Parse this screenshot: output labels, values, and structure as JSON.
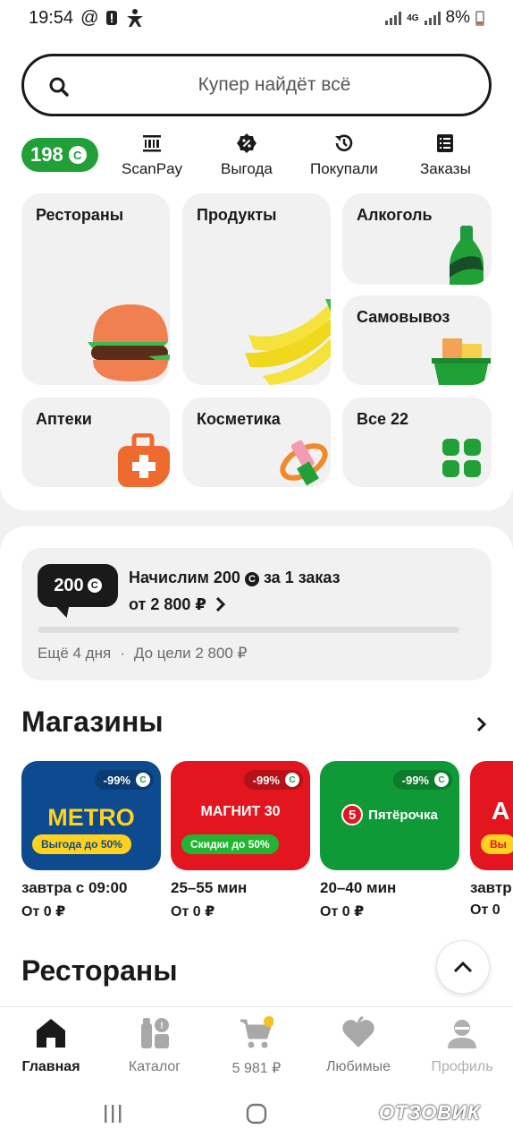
{
  "status_bar": {
    "time": "19:54",
    "battery": "8%",
    "network": "4G"
  },
  "search": {
    "placeholder": "Купер найдёт всё"
  },
  "bonus": {
    "amount": "198",
    "coin_symbol": "С"
  },
  "quick_actions": [
    {
      "label": "ScanPay",
      "icon": "barcode-scan-icon"
    },
    {
      "label": "Выгода",
      "icon": "discount-badge-icon"
    },
    {
      "label": "Покупали",
      "icon": "history-icon"
    },
    {
      "label": "Заказы",
      "icon": "orders-list-icon"
    }
  ],
  "categories": [
    {
      "label": "Рестораны",
      "icon": "burger-icon"
    },
    {
      "label": "Продукты",
      "icon": "banana-icon"
    },
    {
      "label": "Алкоголь",
      "icon": "bottle-icon"
    },
    {
      "label": "Самовывоз",
      "icon": "basket-icon"
    },
    {
      "label": "Аптеки",
      "icon": "first-aid-bag-icon"
    },
    {
      "label": "Косметика",
      "icon": "lipstick-icon"
    },
    {
      "label": "Все 22",
      "icon": "grid-icon"
    }
  ],
  "promo": {
    "bubble_amount": "200",
    "line1_a": "Начислим 200",
    "line1_b": "за 1 заказ",
    "line2": "от 2 800 ₽",
    "progress_fraction": 0.0,
    "days_left": "Ещё 4 дня",
    "separator": "·",
    "goal": "До цели 2 800 ₽"
  },
  "stores_section": {
    "title": "Магазины"
  },
  "stores": [
    {
      "name": "METRO",
      "discount": "-99%",
      "badge": "Выгода до 50%",
      "time": "завтра с 09:00",
      "price": "От 0 ₽",
      "bg": "#0d4a8f",
      "badge_bg": "#ffd21f",
      "badge_color": "#0d4a8f",
      "logo_color": "#ffd21f"
    },
    {
      "name": "МАГНИТ 30",
      "discount": "-99%",
      "badge": "Скидки до 50%",
      "time": "25–55 мин",
      "price": "От 0 ₽",
      "bg": "#e3161f",
      "badge_bg": "#21b532",
      "badge_color": "#ffffff",
      "logo_color": "#ffffff"
    },
    {
      "name": "Пятёрочка",
      "discount": "-99%",
      "badge": "",
      "time": "20–40 мин",
      "price": "От 0 ₽",
      "bg": "#0f9a37",
      "badge_bg": "",
      "badge_color": "#ffffff",
      "logo_color": "#ffffff"
    },
    {
      "name": "А",
      "discount": "",
      "badge": "Вы",
      "time": "завтр",
      "price": "От 0",
      "bg": "#e3161f",
      "badge_bg": "#ffd21f",
      "badge_color": "#e3161f",
      "logo_color": "#ffffff"
    }
  ],
  "restaurants_section": {
    "title": "Рестораны"
  },
  "bottom_nav": [
    {
      "label": "Главная",
      "icon": "home-icon"
    },
    {
      "label": "Каталог",
      "icon": "catalog-icon"
    },
    {
      "label": "5 981 ₽",
      "icon": "cart-icon"
    },
    {
      "label": "Любимые",
      "icon": "heart-icon"
    },
    {
      "label": "Профиль",
      "icon": "profile-icon"
    }
  ],
  "watermark": "ОТЗОВИК",
  "colors": {
    "brand_green": "#21a038",
    "dark": "#1a1a1a",
    "card_bg": "#f1f1f1"
  }
}
